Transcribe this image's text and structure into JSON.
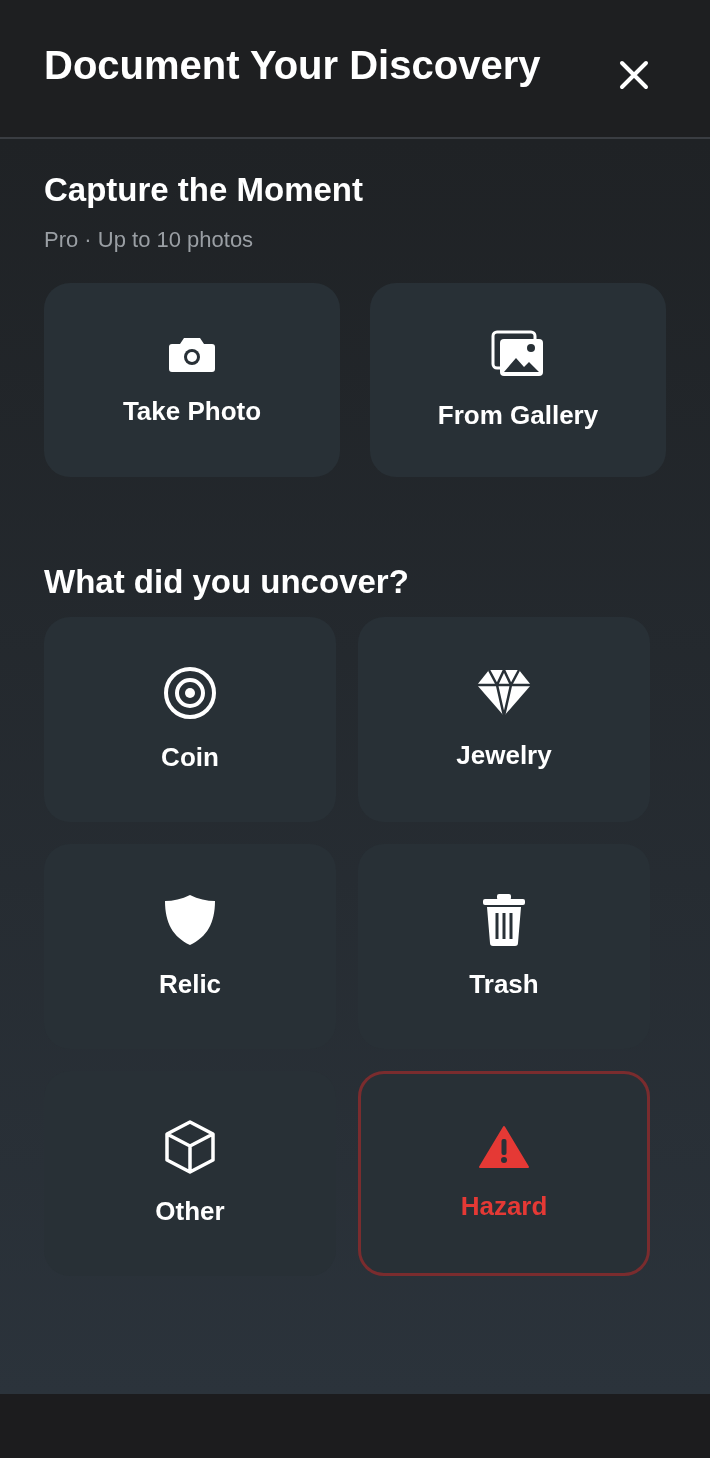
{
  "header": {
    "title": "Document Your Discovery"
  },
  "capture": {
    "title": "Capture the Moment",
    "subtitle": "Pro · Up to 10 photos",
    "buttons": [
      {
        "label": "Take Photo"
      },
      {
        "label": "From Gallery"
      }
    ]
  },
  "categories": {
    "title": "What did you uncover?",
    "items": [
      {
        "label": "Coin",
        "selected": false
      },
      {
        "label": "Jewelry",
        "selected": false
      },
      {
        "label": "Relic",
        "selected": false
      },
      {
        "label": "Trash",
        "selected": false
      },
      {
        "label": "Other",
        "selected": false
      },
      {
        "label": "Hazard",
        "selected": true
      }
    ]
  }
}
